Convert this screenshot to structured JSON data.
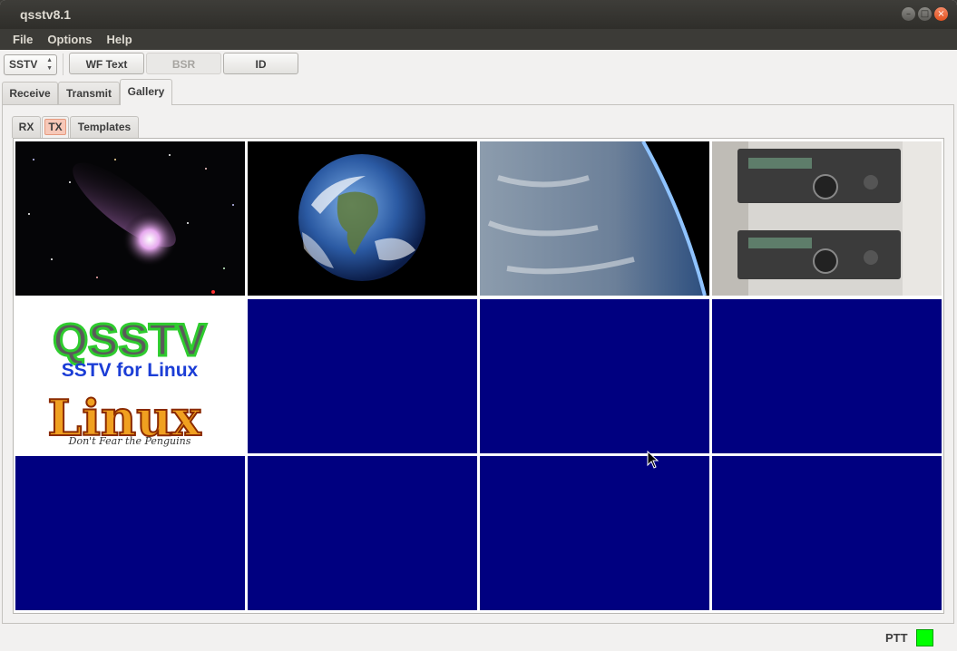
{
  "window": {
    "title": "qsstv8.1"
  },
  "menu": {
    "items": [
      "File",
      "Options",
      "Help"
    ]
  },
  "toolbar": {
    "mode_select": "SSTV",
    "wf_text_label": "WF Text",
    "bsr_label": "BSR",
    "id_label": "ID"
  },
  "main_tabs": [
    "Receive",
    "Transmit",
    "Gallery"
  ],
  "main_tab_active": "Gallery",
  "sub_tabs": [
    "RX",
    "TX",
    "Templates"
  ],
  "sub_tab_active": "TX",
  "gallery": {
    "columns": 4,
    "rows": 3,
    "empty_color": "#000080",
    "logo_texts": {
      "title": "QSSTV",
      "subtitle": "SSTV for Linux",
      "linux": "Linux",
      "tagline": "Don't Fear the Penguins"
    }
  },
  "status": {
    "ptt_label": "PTT",
    "ptt_color": "#00ff00"
  }
}
